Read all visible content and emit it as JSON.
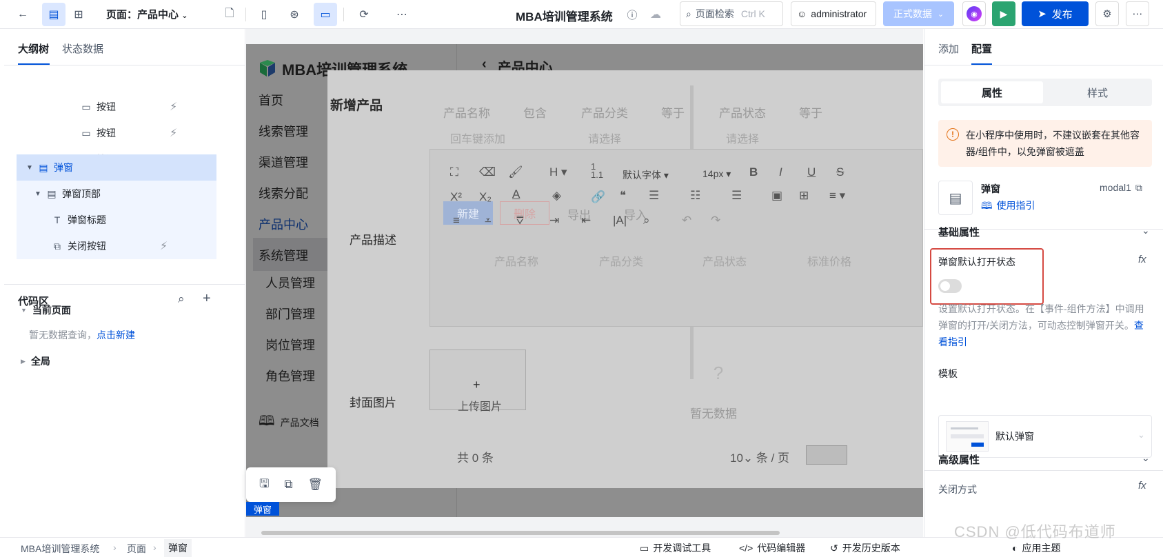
{
  "topbar": {
    "page_label": "页面：产品中心",
    "app_title": "MBA培训管理系统",
    "search_label": "页面检索",
    "search_shortcut": "Ctrl K",
    "user": "administrator",
    "env": "正式数据",
    "publish": "发布"
  },
  "left": {
    "tabs": [
      "大纲树",
      "状态数据"
    ],
    "tree": [
      {
        "label": "按钮"
      },
      {
        "label": "按钮"
      },
      {
        "label": "按钮"
      },
      {
        "label": "弹窗"
      },
      {
        "label": "弹窗顶部"
      },
      {
        "label": "弹窗标题"
      },
      {
        "label": "关闭按钮"
      }
    ],
    "code_title": "代码区",
    "current_page": "当前页面",
    "empty_text": "暂无数据查询，",
    "new_link": "点击新建",
    "global": "全局"
  },
  "canvas": {
    "logo": "MBA培训管理系统",
    "header": "产品中心",
    "menu": [
      "首页",
      "线索管理",
      "渠道管理",
      "线索分配",
      "产品中心",
      "系统管理",
      "人员管理",
      "部门管理",
      "岗位管理",
      "角色管理"
    ],
    "doc_link": "产品文档",
    "modal_title": "新增产品",
    "field_desc": "产品描述",
    "field_cover": "封面图片",
    "upload": "上传图片",
    "filters": [
      "产品名称",
      "包含",
      "产品分类",
      "等于",
      "产品状态",
      "等于"
    ],
    "placeholders": [
      "回车键添加",
      "请选择",
      "请选择"
    ],
    "actions": [
      "新建",
      "删除",
      "导出",
      "导入"
    ],
    "columns": [
      "产品名称",
      "产品分类",
      "产品状态",
      "标准价格"
    ],
    "font_default": "默认字体",
    "font_size": "14px",
    "no_data": "暂无数据",
    "total": "共 0 条",
    "page_size": "10",
    "per_page": "条 / 页",
    "tag": "弹窗"
  },
  "right": {
    "tabs": [
      "添加",
      "配置"
    ],
    "seg": [
      "属性",
      "样式"
    ],
    "warning": "在小程序中使用时，不建议嵌套在其他容器/组件中，以免弹窗被遮盖",
    "comp_name": "弹窗",
    "comp_id": "modal1",
    "guide": "使用指引",
    "basic": "基础属性",
    "default_open": "弹窗默认打开状态",
    "desc": "设置默认打开状态。在【事件-组件方法】中调用弹窗的打开/关闭方法，可动态控制弹窗开关。",
    "view_guide": "查看指引",
    "template": "模板",
    "template_value": "默认弹窗",
    "advanced": "高级属性",
    "close_mode": "关闭方式"
  },
  "status": {
    "crumbs": [
      "MBA培训管理系统",
      "页面",
      "弹窗"
    ],
    "tools": [
      "开发调试工具",
      "代码编辑器",
      "开发历史版本"
    ],
    "theme": "应用主题",
    "watermark": "CSDN @低代码布道师"
  }
}
